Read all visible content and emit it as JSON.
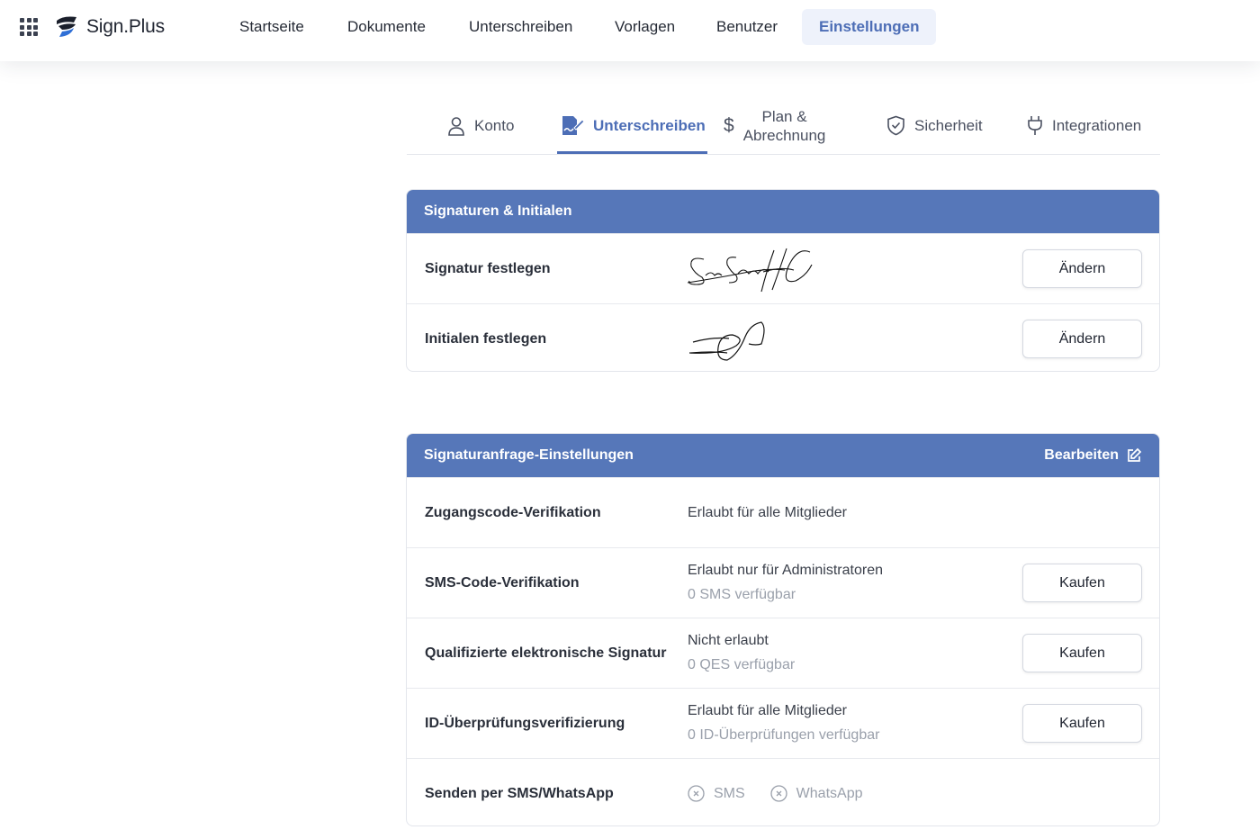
{
  "app": {
    "logo_text": "Sign.Plus"
  },
  "nav": {
    "items": [
      {
        "label": "Startseite"
      },
      {
        "label": "Dokumente"
      },
      {
        "label": "Unterschreiben"
      },
      {
        "label": "Vorlagen"
      },
      {
        "label": "Benutzer"
      },
      {
        "label": "Einstellungen",
        "active": true
      }
    ]
  },
  "tabs": {
    "konto": "Konto",
    "unterschreiben": "Unterschreiben",
    "plan_line1": "Plan &",
    "plan_line2": "Abrechnung",
    "sicherheit": "Sicherheit",
    "integrationen": "Integrationen",
    "active": "Unterschreiben"
  },
  "signatures": {
    "title": "Signaturen & Initialen",
    "rows": [
      {
        "label": "Signatur festlegen",
        "button": "Ändern"
      },
      {
        "label": "Initialen festlegen",
        "button": "Ändern"
      }
    ]
  },
  "request_settings": {
    "title": "Signaturanfrage-Einstellungen",
    "edit_label": "Bearbeiten",
    "rows": [
      {
        "label": "Zugangscode-Verifikation",
        "value": "Erlaubt für alle Mitglieder"
      },
      {
        "label": "SMS-Code-Verifikation",
        "value": "Erlaubt nur für Administratoren",
        "sub": "0 SMS verfügbar",
        "button": "Kaufen"
      },
      {
        "label": "Qualifizierte elektronische Signatur",
        "value": "Nicht erlaubt",
        "sub": "0 QES verfügbar",
        "button": "Kaufen"
      },
      {
        "label": "ID-Überprüfungsverifizierung",
        "value": "Erlaubt für alle Mitglieder",
        "sub": "0 ID-Überprüfungen verfügbar",
        "button": "Kaufen"
      },
      {
        "label": "Senden per SMS/WhatsApp",
        "options": [
          "SMS",
          "WhatsApp"
        ]
      }
    ]
  },
  "colors": {
    "accent": "#5677b9",
    "active_text": "#4d6eb6"
  }
}
